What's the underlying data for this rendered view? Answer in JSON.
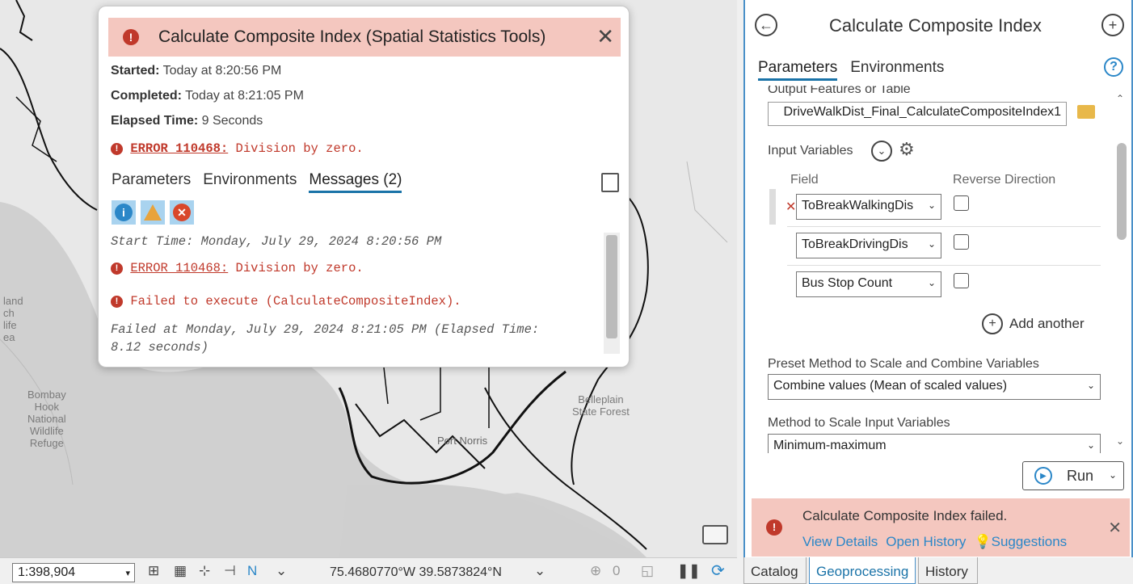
{
  "popup": {
    "title": "Calculate Composite Index (Spatial Statistics Tools)",
    "started_label": "Started:",
    "started_value": "Today at 8:20:56 PM",
    "completed_label": "Completed:",
    "completed_value": "Today at 8:21:05 PM",
    "elapsed_label": "Elapsed Time:",
    "elapsed_value": "9 Seconds",
    "error_code": "ERROR 110468:",
    "error_text": "Division by zero.",
    "tabs": [
      "Parameters",
      "Environments",
      "Messages (2)"
    ],
    "messages": {
      "start": "Start Time: Monday, July 29, 2024 8:20:56 PM",
      "error_code": "ERROR 110468:",
      "error_text": "Division by zero.",
      "failed": "Failed to execute (CalculateCompositeIndex).",
      "failed_at_1": "Failed at Monday, July 29, 2024 8:21:05 PM (Elapsed Time:",
      "failed_at_2": "8.12 seconds)"
    }
  },
  "map_labels": {
    "bombay": [
      "Bombay",
      "Hook",
      "National",
      "Wildlife",
      "Refuge"
    ],
    "belleplain": [
      "Belleplain",
      "State Forest"
    ],
    "port_norris": "Port Norris",
    "left_edge": [
      "land",
      "ch",
      "life",
      "ea"
    ]
  },
  "pane": {
    "title": "Calculate Composite Index",
    "tabs": [
      "Parameters",
      "Environments"
    ],
    "output_label": "Output Features or Table",
    "output_value": "DriveWalkDist_Final_CalculateCompositeIndex1",
    "input_vars_label": "Input Variables",
    "field_header": "Field",
    "reverse_header": "Reverse Direction",
    "fields": [
      "ToBreakWalkingDis",
      "ToBreakDrivingDis",
      "Bus Stop Count"
    ],
    "add_another": "Add another",
    "preset_label": "Preset Method to Scale and Combine Variables",
    "preset_value": "Combine values (Mean of scaled values)",
    "method_label": "Method to Scale Input Variables",
    "method_value": "Minimum-maximum",
    "run_label": "Run",
    "status_text": "Calculate Composite Index failed.",
    "status_links": [
      "View Details",
      "Open History",
      "Suggestions"
    ]
  },
  "bottom": {
    "scale": "1:398,904",
    "coords": "75.4680770°W 39.5873824°N",
    "selected_count": "0"
  },
  "bottom_tabs": [
    "Catalog",
    "Geoprocessing",
    "History"
  ],
  "colors": {
    "error": "#c0392b",
    "accent": "#1a73a8",
    "status_bg": "#f4c7bf"
  }
}
